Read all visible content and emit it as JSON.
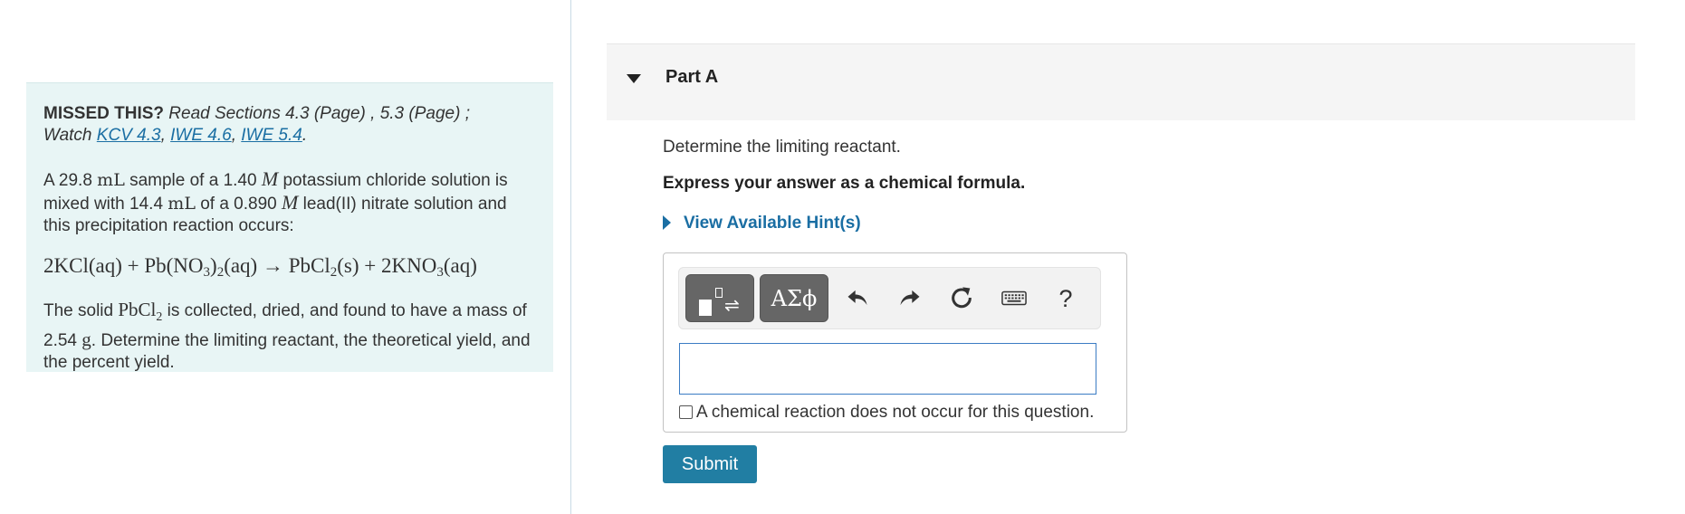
{
  "problem": {
    "missed_label": "MISSED THIS?",
    "read_text": "Read Sections 4.3 (Page) , 5.3 (Page) ;",
    "watch_label": "Watch",
    "links": [
      "KCV 4.3",
      "IWE 4.6",
      "IWE 5.4"
    ],
    "intro": {
      "t1": "A 29.8 ",
      "u1": "mL",
      "t2": " sample of a 1.40 ",
      "m1": "M",
      "t3": " potassium chloride solution is mixed with 14.4 ",
      "u2": "mL",
      "t4": " of a 0.890 ",
      "m2": "M",
      "t5": " lead(II) nitrate solution and this precipitation reaction occurs:"
    },
    "equation": {
      "a": "2KCl(aq) + Pb(NO",
      "s1": "3",
      "b": ")",
      "s2": "2",
      "c": "(aq) → PbCl",
      "s3": "2",
      "d": "(s) + 2KNO",
      "s4": "3",
      "e": "(aq)"
    },
    "solid": {
      "t1": "The solid ",
      "f1": "PbCl",
      "s1": "2",
      "t2": " is collected, dried, and found to have a mass of 2.54 ",
      "u1": "g",
      "t3": ". Determine the limiting reactant, the theoretical yield, and the percent yield."
    }
  },
  "part": {
    "title": "Part A",
    "question": "Determine the limiting reactant.",
    "instruction": "Express your answer as a chemical formula.",
    "hints_label": "View Available Hint(s)"
  },
  "toolbar": {
    "greek_label": "ΑΣϕ",
    "help_label": "?",
    "icons": [
      "templates-icon",
      "greek-symbols-icon",
      "undo-icon",
      "redo-icon",
      "reset-icon",
      "keyboard-icon",
      "help-icon"
    ]
  },
  "answer": {
    "value": "",
    "no_reaction_label": "A chemical reaction does not occur for this question."
  },
  "submit_label": "Submit",
  "colors": {
    "panel_bg": "#e8f5f5",
    "link": "#1a6ea3",
    "submit_bg": "#217ea3",
    "input_border": "#3b7cc4"
  }
}
